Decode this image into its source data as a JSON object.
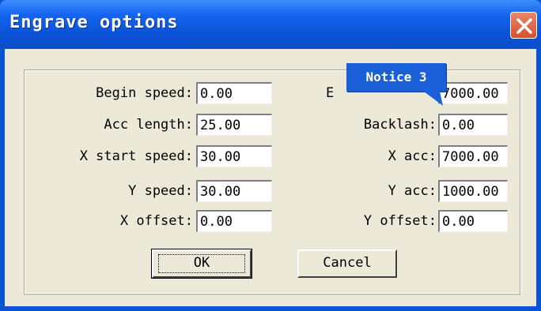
{
  "window": {
    "title": "Engrave options"
  },
  "tooltip": {
    "text": "Notice 3"
  },
  "fields_left": [
    {
      "label": "Begin speed:",
      "value": "0.00"
    },
    {
      "label": "Acc length:",
      "value": "25.00"
    },
    {
      "label": "X start speed:",
      "value": "30.00"
    },
    {
      "label": "Y speed:",
      "value": "30.00"
    },
    {
      "label": "X offset:",
      "value": "0.00"
    }
  ],
  "fields_right": [
    {
      "label": "E",
      "value": "7000.00"
    },
    {
      "label": "Backlash:",
      "value": "0.00"
    },
    {
      "label": "X acc:",
      "value": "7000.00"
    },
    {
      "label": "Y acc:",
      "value": "1000.00"
    },
    {
      "label": "Y offset:",
      "value": "0.00"
    }
  ],
  "buttons": {
    "ok": "OK",
    "cancel": "Cancel"
  },
  "colors": {
    "titlebar": "#0a52d6",
    "close_button": "#d6502a",
    "face": "#ece9d8",
    "tooltip": "#1a5fd8"
  },
  "icons": {
    "close": "close-icon"
  }
}
